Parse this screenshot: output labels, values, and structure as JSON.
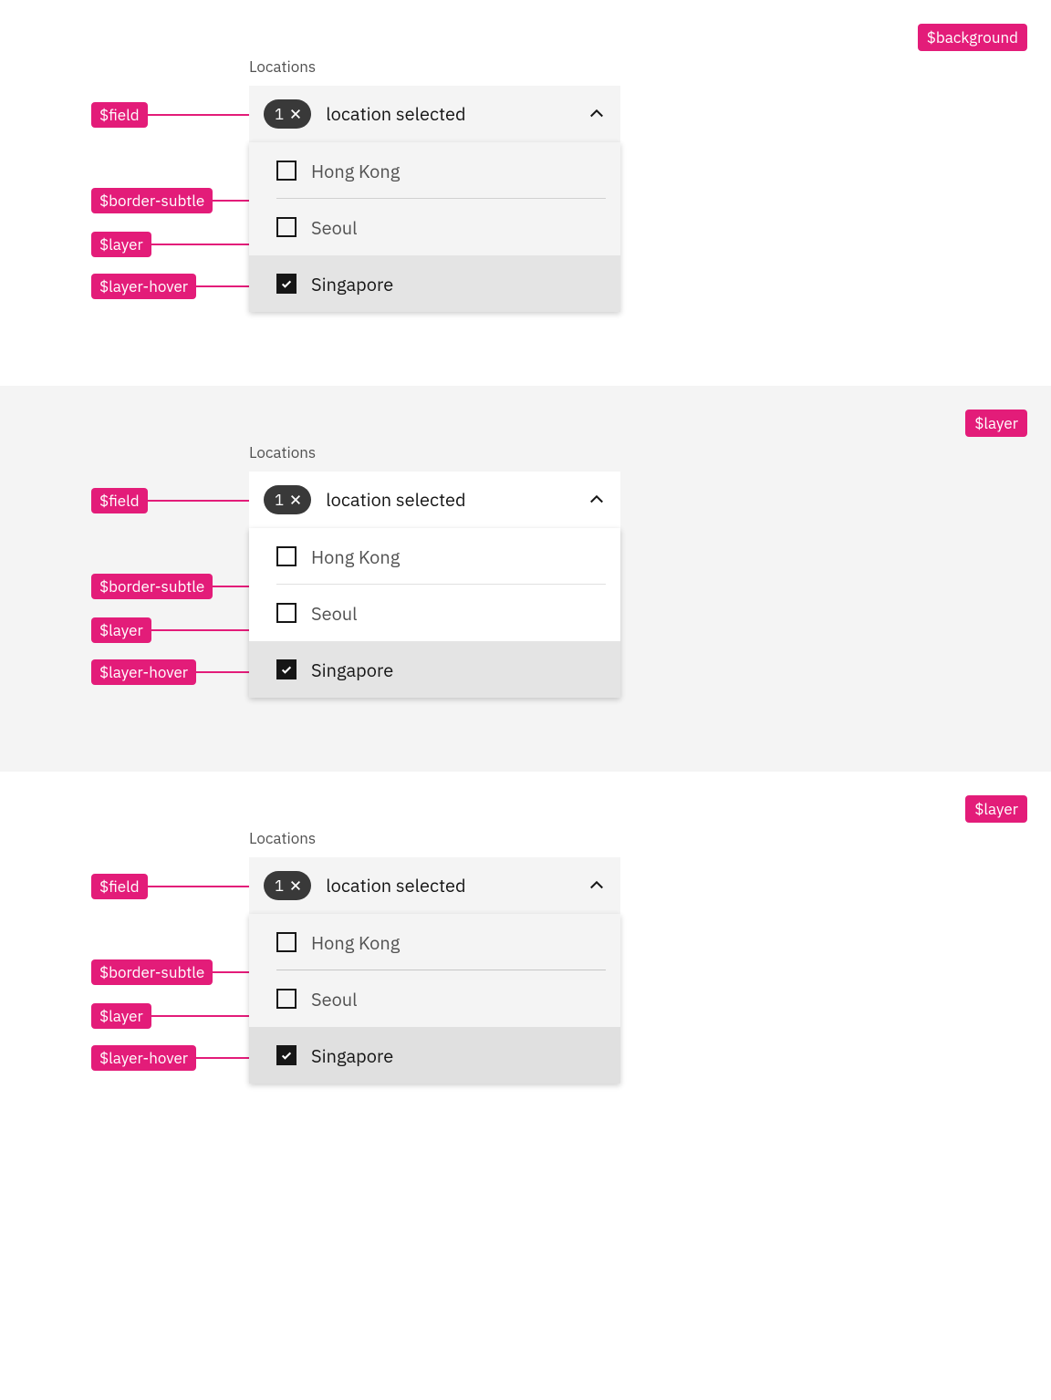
{
  "annotation_color": "#e31c79",
  "sections": [
    {
      "context_token": "$background",
      "context_bg": "#ffffff",
      "annotations": {
        "field": "$field",
        "border_subtle": "$border-subtle",
        "layer": "$layer",
        "layer_hover": "$layer-hover"
      },
      "field_bg": "#f4f4f4",
      "layer_bg": "#f4f4f4",
      "layer_hover_bg": "#e4e4e4",
      "border_subtle_color": "#d1d1d1",
      "multiselect": {
        "label": "Locations",
        "selected_count": "1",
        "placeholder": "location selected",
        "open": true,
        "options": [
          {
            "label": "Hong Kong",
            "checked": false,
            "hover": false
          },
          {
            "label": "Seoul",
            "checked": false,
            "hover": false
          },
          {
            "label": "Singapore",
            "checked": true,
            "hover": true
          }
        ]
      }
    },
    {
      "context_token": "$layer",
      "context_bg": "#f4f4f4",
      "annotations": {
        "field": "$field",
        "border_subtle": "$border-subtle",
        "layer": "$layer",
        "layer_hover": "$layer-hover"
      },
      "field_bg": "#ffffff",
      "layer_bg": "#ffffff",
      "layer_hover_bg": "#e4e4e4",
      "border_subtle_color": "#e0e0e0",
      "multiselect": {
        "label": "Locations",
        "selected_count": "1",
        "placeholder": "location selected",
        "open": true,
        "options": [
          {
            "label": "Hong Kong",
            "checked": false,
            "hover": false
          },
          {
            "label": "Seoul",
            "checked": false,
            "hover": false
          },
          {
            "label": "Singapore",
            "checked": true,
            "hover": true
          }
        ]
      }
    },
    {
      "context_token": "$layer",
      "context_bg": "#ffffff",
      "annotations": {
        "field": "$field",
        "border_subtle": "$border-subtle",
        "layer": "$layer",
        "layer_hover": "$layer-hover"
      },
      "field_bg": "#f4f4f4",
      "layer_bg": "#f4f4f4",
      "layer_hover_bg": "#e0e0e0",
      "border_subtle_color": "#c6c6c6",
      "multiselect": {
        "label": "Locations",
        "selected_count": "1",
        "placeholder": "location selected",
        "open": true,
        "options": [
          {
            "label": "Hong Kong",
            "checked": false,
            "hover": false
          },
          {
            "label": "Seoul",
            "checked": false,
            "hover": false
          },
          {
            "label": "Singapore",
            "checked": true,
            "hover": true
          }
        ]
      }
    }
  ]
}
